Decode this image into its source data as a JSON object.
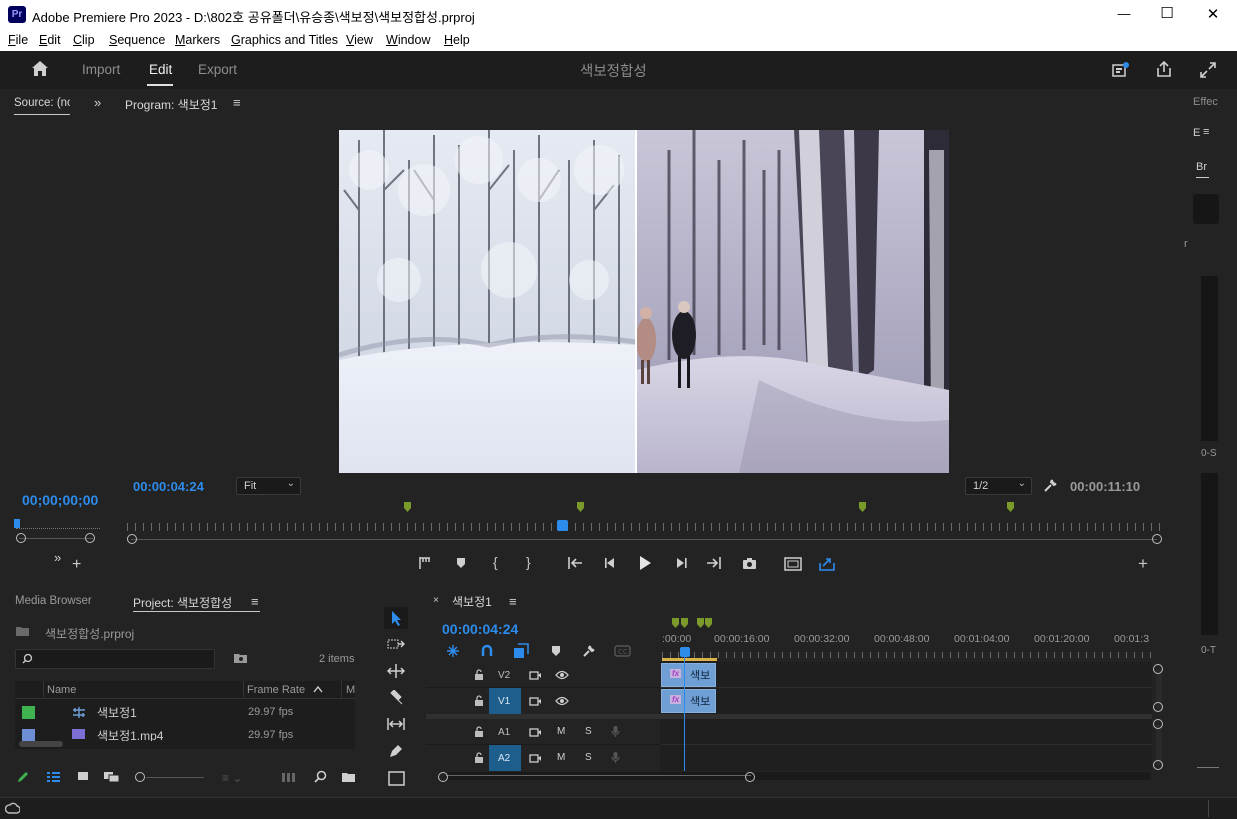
{
  "window": {
    "title": "Adobe Premiere Pro 2023 - D:\\802호 공유폴더\\유승종\\색보정\\색보정합성.prproj",
    "app_badge": "Pr",
    "minimize": "—",
    "maximize": "☐",
    "close": "✕"
  },
  "menu": [
    "File",
    "Edit",
    "Clip",
    "Sequence",
    "Markers",
    "Graphics and Titles",
    "View",
    "Window",
    "Help"
  ],
  "header": {
    "tabs": [
      "Import",
      "Edit",
      "Export"
    ],
    "active_tab": "Edit",
    "project_title": "색보정합성"
  },
  "source": {
    "tab": "Source: (no",
    "timecode": "00;00;00;00"
  },
  "program": {
    "tab": "Program: 색보정1",
    "timecode": "00:00:04:24",
    "fit": "Fit",
    "resolution": "1/2",
    "duration": "00:00:11:10"
  },
  "effects": {
    "tab": "Effec",
    "sub1": "E",
    "sub2": "Br",
    "r": "r",
    "meter1": "0-S",
    "meter2": "0-T"
  },
  "project": {
    "tabs": [
      "Media Browser",
      "Project: 색보정합성"
    ],
    "file": "색보정합성.prproj",
    "items_count": "2 items",
    "columns": [
      "Name",
      "Frame Rate",
      "M"
    ],
    "rows": [
      {
        "color": "#3fb34f",
        "name": "색보정1",
        "fps": "29.97 fps"
      },
      {
        "color": "#6e8fd6",
        "name": "색보정1.mp4",
        "fps": "29.97 fps"
      }
    ]
  },
  "timeline": {
    "tab": "색보정1",
    "timecode": "00:00:04:24",
    "ruler": [
      ":00:00",
      "00:00:16:00",
      "00:00:32:00",
      "00:00:48:00",
      "00:01:04:00",
      "00:01:20:00",
      "00:01:3"
    ],
    "tracks": [
      {
        "label": "V2",
        "clip": "색보"
      },
      {
        "label": "V1",
        "clip": "색보"
      },
      {
        "label": "A1",
        "m": "M",
        "s": "S"
      },
      {
        "label": "A2",
        "m": "M",
        "s": "S"
      }
    ],
    "fx": "fx"
  },
  "colors": {
    "accent": "#2d8ceb",
    "marker": "#7a9a2a",
    "clip": "#6f9fd4"
  }
}
